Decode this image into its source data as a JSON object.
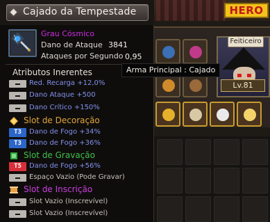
{
  "hud": {
    "hero_label": "HERO",
    "portrait": {
      "job_tag": "Feiticeiro",
      "level": "Lv.81"
    }
  },
  "item": {
    "title": "Cajado da Tempestade",
    "rarity": "Grau Cósmico",
    "attack_label": "Dano de Ataque",
    "attack_value": "3841",
    "speed_label": "Ataques por Segundo",
    "speed_value": "0,95",
    "icon": "staff-icon"
  },
  "inherent": {
    "title": "Atributos Inerentes",
    "lines": [
      "Red. Recarga +12,0%",
      "Dano Ataque +500",
      "Dano Crítico +150%"
    ]
  },
  "decoration": {
    "title": "Slot de Decoração",
    "color": "#e0a63a",
    "lines": [
      {
        "tier": "T3",
        "text": "Dano de Fogo +34%"
      },
      {
        "tier": "T3",
        "text": "Dano de Fogo +36%"
      }
    ]
  },
  "engraving": {
    "title": "Slot de Gravação",
    "color": "#3fc24a",
    "lines": [
      {
        "tier": "T5",
        "text": "Dano de Fogo +56%"
      },
      {
        "tier": "-",
        "text": "Espaço Vazio (Pode Gravar)"
      }
    ]
  },
  "inscription": {
    "title": "Slot de Inscrição",
    "color": "#cc3ee0",
    "lines": [
      "Slot Vazio (Inscrevível)",
      "Slot Vazio (Inscrevível)"
    ]
  },
  "hover_tooltip": "Arma Principal : Cajado",
  "colors": {
    "stat_blue": "#8290ec",
    "rarity_purple": "#ca2de1",
    "tier3_blue": "#2c66c9",
    "tier5_red": "#d8303a"
  }
}
